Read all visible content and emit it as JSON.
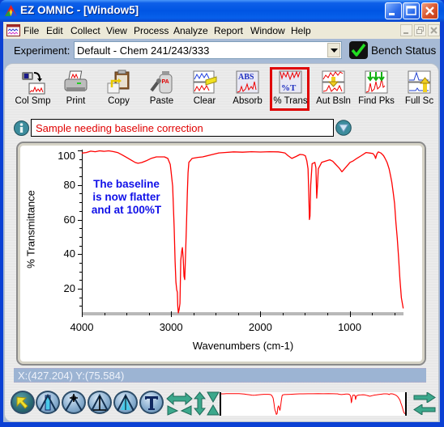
{
  "window": {
    "title": "EZ OMNIC - [Window5]",
    "controls": [
      "minimize",
      "maximize",
      "close"
    ]
  },
  "menu": {
    "items": [
      "File",
      "Edit",
      "Collect",
      "View",
      "Process",
      "Analyze",
      "Report",
      "Window",
      "Help"
    ],
    "mdi_controls": [
      "minimize",
      "restore",
      "close"
    ]
  },
  "experiment": {
    "label": "Experiment:",
    "value": "Default - Chem 241/243/333"
  },
  "bench_status": {
    "label": "Bench Status",
    "state": "ok",
    "color": "#22DD22"
  },
  "toolbar": {
    "buttons": [
      {
        "label": "Col Smp",
        "icon": "collect-sample-icon"
      },
      {
        "label": "Print",
        "icon": "printer-icon"
      },
      {
        "label": "Copy",
        "icon": "copy-icon"
      },
      {
        "label": "Paste",
        "icon": "paste-icon"
      },
      {
        "label": "Clear",
        "icon": "clear-icon"
      },
      {
        "label": "Absorb",
        "icon": "absorbance-icon"
      },
      {
        "label": "% Trans",
        "icon": "percent-transmittance-icon",
        "highlighted": true
      },
      {
        "label": "Aut Bsln",
        "icon": "auto-baseline-icon"
      },
      {
        "label": "Find Pks",
        "icon": "find-peaks-icon"
      },
      {
        "label": "Full Sc",
        "icon": "full-scale-icon"
      }
    ],
    "highlight_color": "#E00000"
  },
  "spectrum_title": "Sample needing baseline correction",
  "status": {
    "cursor": "X:(427.204) Y:(75.584)"
  },
  "bottom_tools": [
    "selection-tool",
    "region-tool",
    "peak-height-tool",
    "peak-label-tool",
    "peak-area-tool",
    "text-annotation-tool",
    "expand-horizontal",
    "expand-vertical",
    "contract-vertical",
    "scroll-right",
    "scroll-left"
  ],
  "colors": {
    "spectrum": "#FF0000",
    "annotation": "#1010E8",
    "title_text": "#E00000",
    "status_bar": "#9CB4D3"
  },
  "chart_data": {
    "type": "line",
    "title": "Sample needing baseline correction",
    "xlabel": "Wavenumbers (cm-1)",
    "ylabel": "% Transmittance",
    "xlim": [
      4000,
      397
    ],
    "ylim": [
      5.5,
      100.5
    ],
    "x_ticks": [
      "4000",
      "3000",
      "2000",
      "1000"
    ],
    "y_ticks": [
      "100",
      "80",
      "60",
      "40",
      "20"
    ],
    "x_minor_step": 250,
    "y_minor_step": 5,
    "grid": false,
    "legend": "none",
    "annotations": [
      "The baseline",
      "is now flatter",
      "and at 100%T"
    ],
    "x": [
      4000,
      3950,
      3900,
      3850,
      3800,
      3750,
      3700,
      3650,
      3600,
      3550,
      3500,
      3450,
      3400,
      3370,
      3330,
      3280,
      3220,
      3165,
      3074,
      3037,
      3010,
      3001,
      2983,
      2965,
      2955,
      2946,
      2937,
      2930,
      2925,
      2919,
      2910,
      2901,
      2892,
      2880,
      2874,
      2865,
      2856,
      2847,
      2837,
      2828,
      2818,
      2810,
      2801,
      2765,
      2700,
      2647,
      2550,
      2465,
      2400,
      2300,
      2200,
      2100,
      2000,
      1900,
      1800,
      1750,
      1723,
      1690,
      1648,
      1600,
      1557,
      1520,
      1496,
      1480,
      1466,
      1458,
      1451,
      1444,
      1436,
      1421,
      1390,
      1378,
      1369,
      1360,
      1351,
      1314,
      1260,
      1223,
      1190,
      1163,
      1120,
      1087,
      1040,
      996,
      960,
      921,
      870,
      815,
      770,
      739,
      720,
      709,
      695,
      678,
      648,
      620,
      603,
      580,
      558,
      540,
      528,
      510,
      497,
      482,
      467,
      451,
      437,
      421,
      400
    ],
    "series": [
      {
        "name": "Sample needing baseline correction",
        "color": "#FF0000",
        "values": [
          98.5,
          98.8,
          99.6,
          99.3,
          99.8,
          99.5,
          99.8,
          99.4,
          98.8,
          97.5,
          96.0,
          94.5,
          93.0,
          92.6,
          93.0,
          94.0,
          95.5,
          96.3,
          96.3,
          95.4,
          92.0,
          88.0,
          79.3,
          54.8,
          36.0,
          24.0,
          19.4,
          18.0,
          10.0,
          6.0,
          8.0,
          11.5,
          36.4,
          42.0,
          43.8,
          37.8,
          27.2,
          25.3,
          41.0,
          56.2,
          75.0,
          87.1,
          93.1,
          95.4,
          96.0,
          96.3,
          97.5,
          98.6,
          98.8,
          99.2,
          99.0,
          99.3,
          99.1,
          99.3,
          99.2,
          98.8,
          98.5,
          97.0,
          95.4,
          96.5,
          97.7,
          97.5,
          96.9,
          94.0,
          89.3,
          75.0,
          60.0,
          62.0,
          80.0,
          92.3,
          93.1,
          90.0,
          72.4,
          80.0,
          89.4,
          93.1,
          94.0,
          94.6,
          93.8,
          92.3,
          90.0,
          87.7,
          90.5,
          93.1,
          94.0,
          95.4,
          97.0,
          98.8,
          98.5,
          98.2,
          97.0,
          95.4,
          98.0,
          99.2,
          98.5,
          97.0,
          95.4,
          93.0,
          89.3,
          85.0,
          81.6,
          75.0,
          69.3,
          58.5,
          49.3,
          37.8,
          25.5,
          14.7,
          8.6
        ]
      }
    ]
  }
}
